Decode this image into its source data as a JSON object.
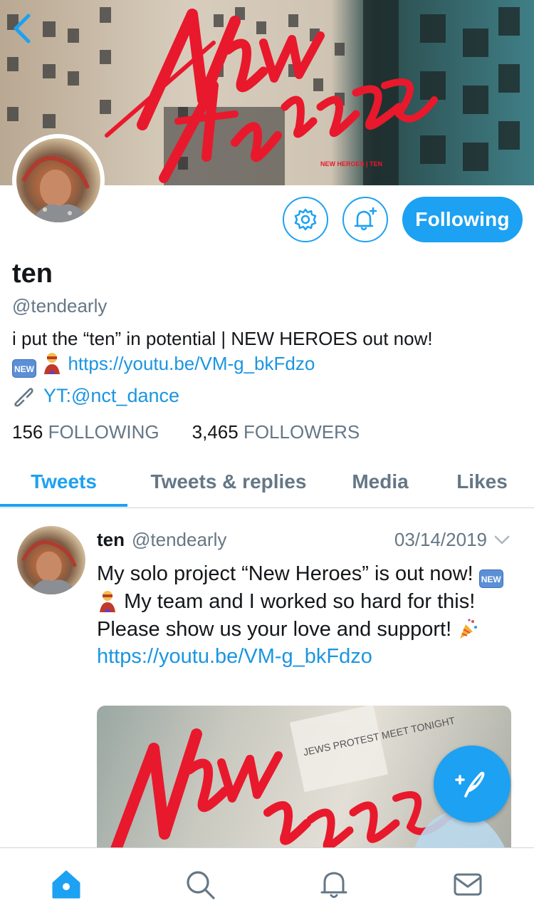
{
  "banner": {
    "title_art": "New Heroes",
    "small_text": "NEW HEROES | TEN"
  },
  "profile": {
    "display_name": "ten",
    "handle": "@tendearly",
    "bio_line1": "i put the “ten” in potential | NEW HEROES out now!",
    "bio_new_emoji": "NEW",
    "bio_link": "https://youtu.be/VM-g_bkFdzo",
    "website": "YT:@nct_dance",
    "following_count": "156",
    "following_label": "FOLLOWING",
    "followers_count": "3,465",
    "followers_label": "FOLLOWERS"
  },
  "actions": {
    "following_label": "Following"
  },
  "tabs": [
    {
      "label": "Tweets",
      "active": true
    },
    {
      "label": "Tweets & replies",
      "active": false
    },
    {
      "label": "Media",
      "active": false
    },
    {
      "label": "Likes",
      "active": false
    }
  ],
  "tweet": {
    "name": "ten",
    "handle": "@tendearly",
    "date": "03/14/2019",
    "text_part1": "My solo project “New Heroes” is out now!",
    "new_emoji": "NEW",
    "text_part2": "My team and I worked so hard for this! Please show us your love and support!",
    "link": "https://youtu.be/VM-g_bkFdzo",
    "media_art": "New Heroes",
    "media_paper_text": "JEWS PROTEST MEET TONIGHT"
  },
  "colors": {
    "accent": "#1da1f2",
    "link": "#1b95e0",
    "muted": "#657786",
    "text": "#14171a",
    "banner_red": "#e8192c"
  },
  "icons": {
    "back": "chevron-left-icon",
    "settings": "gear-icon",
    "notify": "bell-plus-icon",
    "link": "link-icon",
    "caret": "chevron-down-icon",
    "compose": "feather-plus-icon",
    "home": "home-icon",
    "search": "search-icon",
    "notifications": "bell-icon",
    "messages": "envelope-icon"
  }
}
